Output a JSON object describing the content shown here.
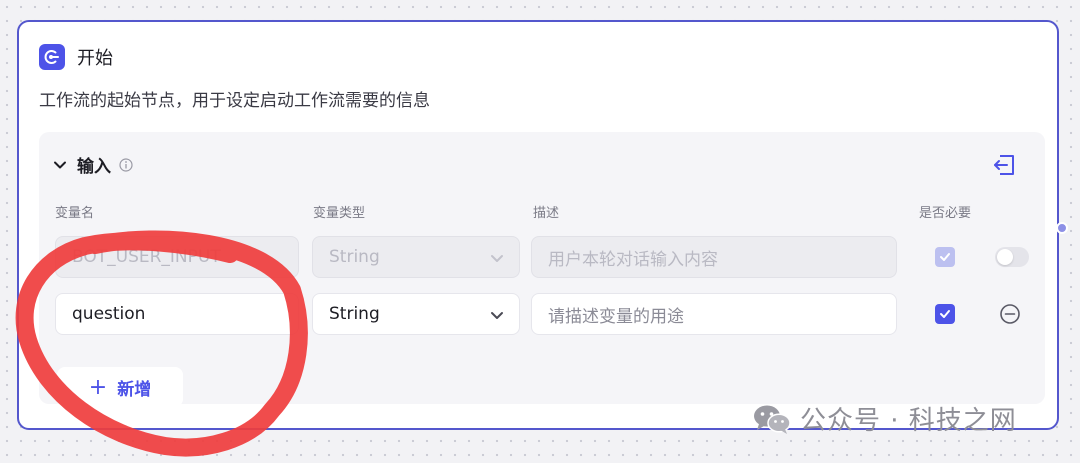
{
  "node": {
    "title": "开始",
    "description": "工作流的起始节点，用于设定启动工作流需要的信息",
    "icon": "start-node-icon",
    "accent_color": "#4d53e8"
  },
  "input_section": {
    "title": "输入",
    "info_icon": "info-circle-icon",
    "collapse_icon": "collapse-panel-icon",
    "columns": {
      "name": "变量名",
      "type": "变量类型",
      "description": "描述",
      "required": "是否必要"
    },
    "rows": [
      {
        "name": "BOT_USER_INPUT",
        "type": "String",
        "description": "用户本轮对话输入内容",
        "required": true,
        "disabled": true
      },
      {
        "name": "question",
        "type": "String",
        "description_placeholder": "请描述变量的用途",
        "required": true,
        "disabled": false
      }
    ],
    "add_button": {
      "plus": "+",
      "label": "新增"
    }
  },
  "annotation": {
    "color": "#ef3d3d",
    "shape": "freehand-circle"
  },
  "watermark": {
    "text": "公众号 · 科技之网",
    "icon": "wechat-icon"
  }
}
